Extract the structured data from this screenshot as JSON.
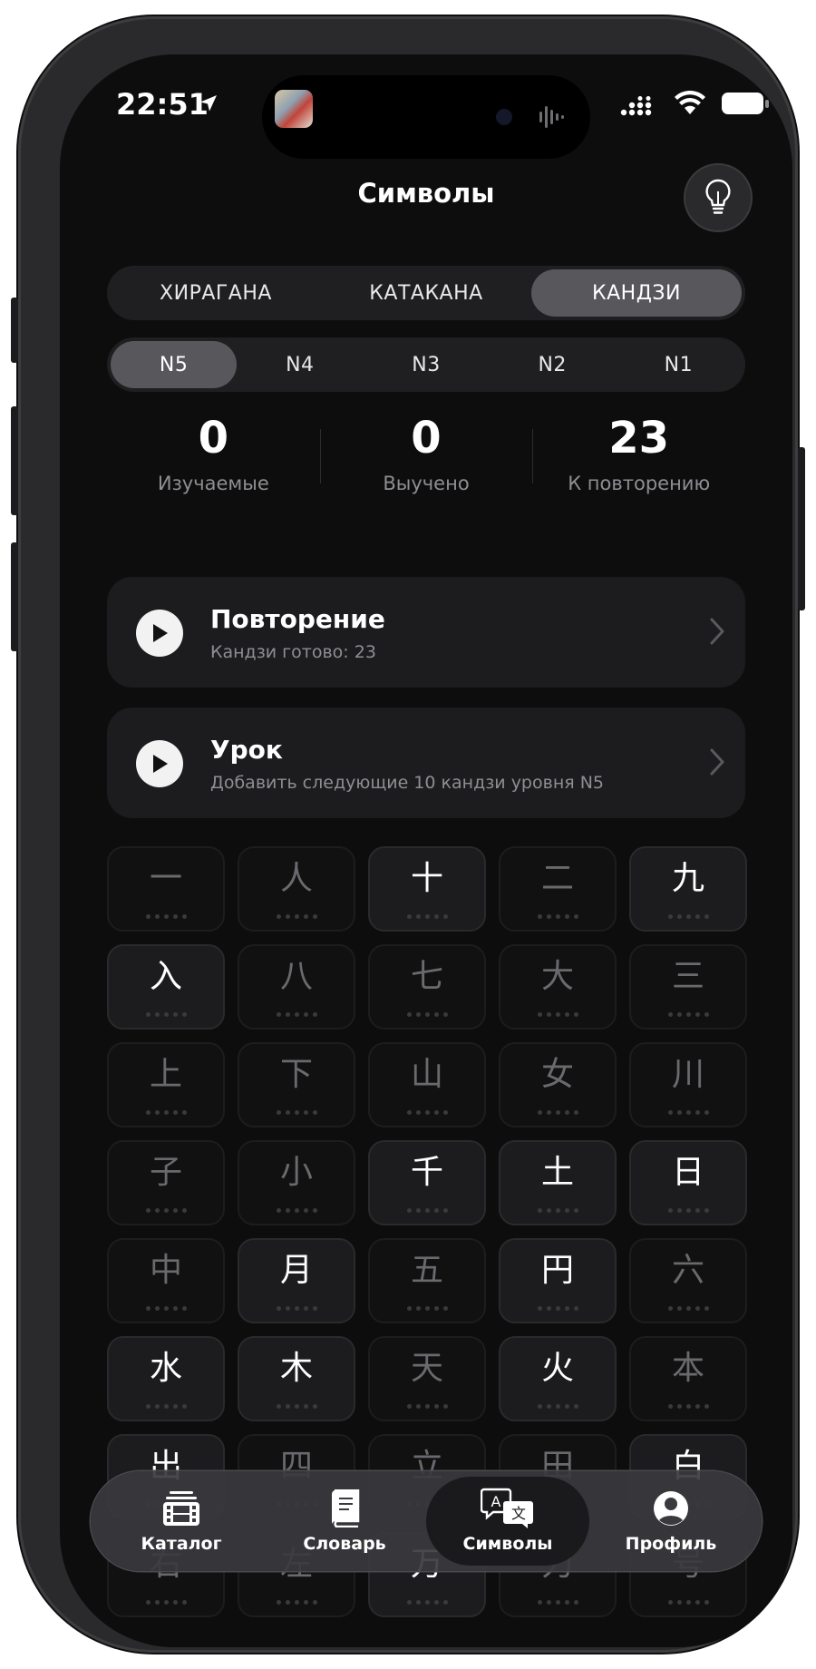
{
  "status_bar": {
    "time": "22:51"
  },
  "header": {
    "title": "Символы",
    "hint_icon": "lightbulb-icon"
  },
  "script_tabs": [
    {
      "label": "ХИРАГАНА",
      "active": false
    },
    {
      "label": "КАТАКАНА",
      "active": false
    },
    {
      "label": "КАНДЗИ",
      "active": true
    }
  ],
  "level_tabs": [
    {
      "label": "N5",
      "active": true
    },
    {
      "label": "N4",
      "active": false
    },
    {
      "label": "N3",
      "active": false
    },
    {
      "label": "N2",
      "active": false
    },
    {
      "label": "N1",
      "active": false
    }
  ],
  "stats": [
    {
      "value": "0",
      "label": "Изучаемые"
    },
    {
      "value": "0",
      "label": "Выучено"
    },
    {
      "value": "23",
      "label": "К повторению"
    }
  ],
  "actions": [
    {
      "title": "Повторение",
      "subtitle": "Кандзи готово: 23"
    },
    {
      "title": "Урок",
      "subtitle": "Добавить следующие 10 кандзи уровня N5"
    }
  ],
  "kanji": [
    {
      "char": "一",
      "highlight": false
    },
    {
      "char": "人",
      "highlight": false
    },
    {
      "char": "十",
      "highlight": true
    },
    {
      "char": "二",
      "highlight": false
    },
    {
      "char": "九",
      "highlight": true
    },
    {
      "char": "入",
      "highlight": true
    },
    {
      "char": "八",
      "highlight": false
    },
    {
      "char": "七",
      "highlight": false
    },
    {
      "char": "大",
      "highlight": false
    },
    {
      "char": "三",
      "highlight": false
    },
    {
      "char": "上",
      "highlight": false
    },
    {
      "char": "下",
      "highlight": false
    },
    {
      "char": "山",
      "highlight": false
    },
    {
      "char": "女",
      "highlight": false
    },
    {
      "char": "川",
      "highlight": false
    },
    {
      "char": "子",
      "highlight": false
    },
    {
      "char": "小",
      "highlight": false
    },
    {
      "char": "千",
      "highlight": true
    },
    {
      "char": "土",
      "highlight": true
    },
    {
      "char": "日",
      "highlight": true
    },
    {
      "char": "中",
      "highlight": false
    },
    {
      "char": "月",
      "highlight": true
    },
    {
      "char": "五",
      "highlight": false
    },
    {
      "char": "円",
      "highlight": true
    },
    {
      "char": "六",
      "highlight": false
    },
    {
      "char": "水",
      "highlight": true
    },
    {
      "char": "木",
      "highlight": true
    },
    {
      "char": "天",
      "highlight": false
    },
    {
      "char": "火",
      "highlight": true
    },
    {
      "char": "本",
      "highlight": false
    },
    {
      "char": "出",
      "highlight": true
    },
    {
      "char": "四",
      "highlight": false
    },
    {
      "char": "立",
      "highlight": false
    },
    {
      "char": "田",
      "highlight": false
    },
    {
      "char": "白",
      "highlight": true
    },
    {
      "char": "右",
      "highlight": false
    },
    {
      "char": "左",
      "highlight": false
    },
    {
      "char": "万",
      "highlight": true
    },
    {
      "char": "力",
      "highlight": false
    },
    {
      "char": "号",
      "highlight": false
    }
  ],
  "tab_bar": [
    {
      "label": "Каталог",
      "icon": "catalog-icon",
      "active": false
    },
    {
      "label": "Словарь",
      "icon": "dictionary-icon",
      "active": false
    },
    {
      "label": "Символы",
      "icon": "translate-icon",
      "active": true
    },
    {
      "label": "Профиль",
      "icon": "profile-icon",
      "active": false
    }
  ]
}
